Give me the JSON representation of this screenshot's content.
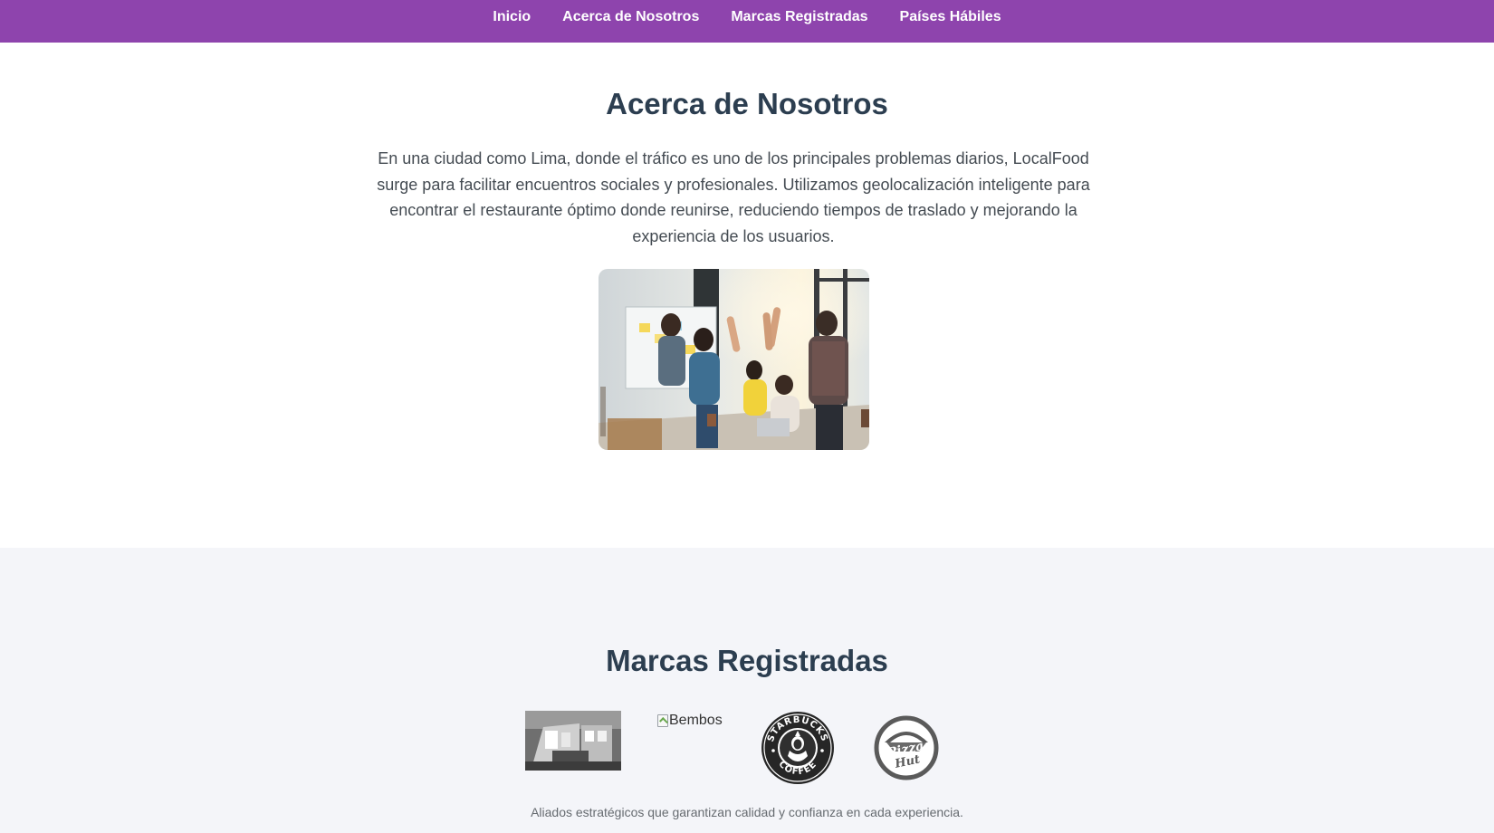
{
  "nav": {
    "items": [
      {
        "label": "Inicio"
      },
      {
        "label": "Acerca de Nosotros"
      },
      {
        "label": "Marcas Registradas"
      },
      {
        "label": "Países Hábiles"
      }
    ]
  },
  "about": {
    "title": "Acerca de Nosotros",
    "text": "En una ciudad como Lima, donde el tráfico es uno de los principales problemas diarios, LocalFood surge para facilitar encuentros sociales y profesionales. Utilizamos geolocalización inteligente para encontrar el restaurante óptimo donde reunirse, reduciendo tiempos de traslado y mejorando la experiencia de los usuarios."
  },
  "brands": {
    "title": "Marcas Registradas",
    "logos": [
      {
        "icon": "kfc-storefront-logo"
      },
      {
        "alt": "Bembos",
        "icon": "broken-image-icon"
      },
      {
        "icon": "starbucks-coffee-logo",
        "wordmark": "STARBUCKS COFFEE"
      },
      {
        "icon": "pizza-hut-logo",
        "wordmark": "Pizza Hut"
      }
    ],
    "caption": "Aliados estratégicos que garantizan calidad y confianza en cada experiencia."
  },
  "colors": {
    "nav_bg": "#8e44ad",
    "heading": "#2c3e50",
    "brands_bg": "#f4f5f9"
  }
}
